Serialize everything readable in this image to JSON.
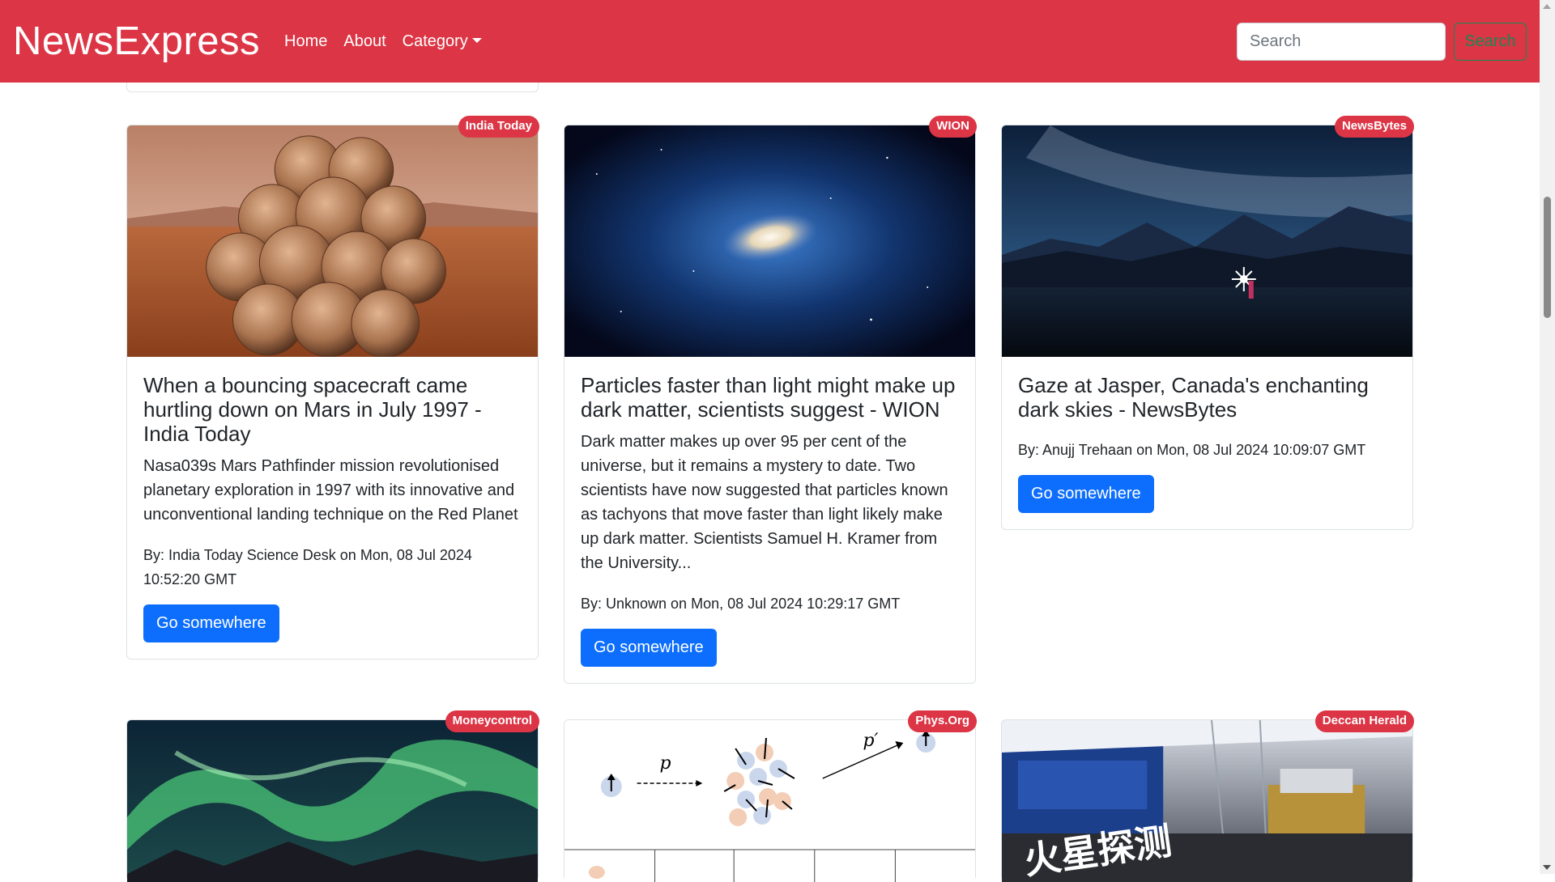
{
  "navbar": {
    "brand": "NewsExpress",
    "links": [
      "Home",
      "About",
      "Category"
    ],
    "search_placeholder": "Search",
    "search_button": "Search"
  },
  "colors": {
    "navbar": "#dc3545",
    "badge": "#dc3545",
    "primary_button": "#0d6efd",
    "search_button": "#198754"
  },
  "cards": [
    {
      "source": "India Today",
      "title": "When a bouncing spacecraft came hurtling down on Mars in July 1997 - India Today",
      "description": "Nasa039s Mars Pathfinder mission revolutionised planetary exploration in 1997 with its innovative and unconventional landing technique on the Red Planet",
      "meta": "By: India Today Science Desk on Mon, 08 Jul 2024 10:52:20 GMT",
      "button": "Go somewhere"
    },
    {
      "source": "WION",
      "title": "Particles faster than light might make up dark matter, scientists suggest - WION",
      "description": "Dark matter makes up over 95 per cent of the universe, but it remains a mystery to date. Two scientists have now suggested that particles known as tachyons that move faster than light likely make up dark matter. Scientists Samuel H. Kramer from the University...",
      "meta": "By: Unknown on Mon, 08 Jul 2024 10:29:17 GMT",
      "button": "Go somewhere"
    },
    {
      "source": "NewsBytes",
      "title": "Gaze at Jasper, Canada's enchanting dark skies - NewsBytes",
      "description": "",
      "meta": "By: Anujj Trehaan on Mon, 08 Jul 2024 10:09:07 GMT",
      "button": "Go somewhere"
    },
    {
      "source": "Moneycontrol"
    },
    {
      "source": "Phys.Org",
      "image_labels": {
        "p": "p",
        "p_prime": "p′"
      }
    },
    {
      "source": "Deccan Herald",
      "image_text": "火星探测"
    }
  ]
}
